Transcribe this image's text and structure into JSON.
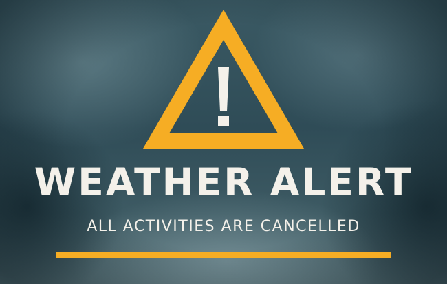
{
  "alert": {
    "headline": "WEATHER ALERT",
    "message": "ALL ACTIVITIES ARE CANCELLED",
    "icon": "warning-triangle-icon"
  },
  "colors": {
    "accent": "#f6ad24",
    "text": "#f4f1ea",
    "background": "#2e4a55"
  }
}
